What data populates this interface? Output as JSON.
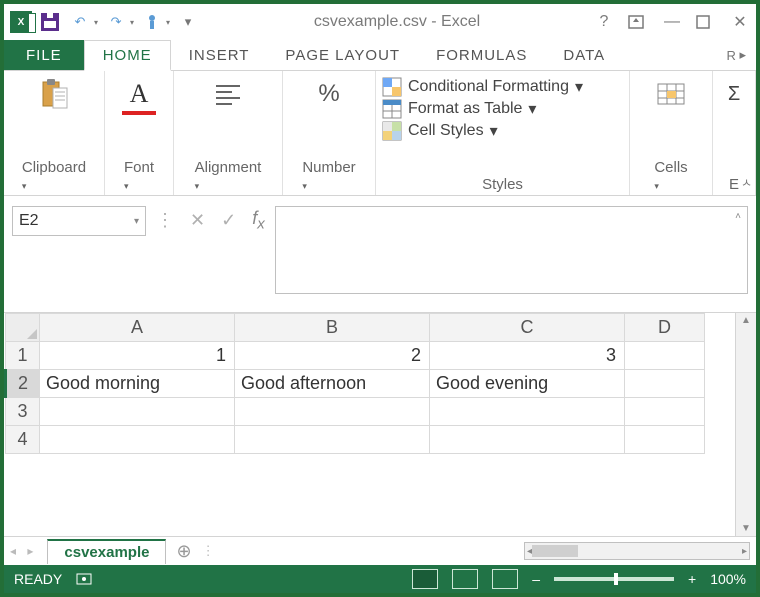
{
  "title": "csvexample.csv - Excel",
  "tabs": {
    "file": "FILE",
    "home": "HOME",
    "insert": "INSERT",
    "page_layout": "PAGE LAYOUT",
    "formulas": "FORMULAS",
    "data": "DATA",
    "overflow": "R"
  },
  "ribbon": {
    "clipboard": "Clipboard",
    "font": "Font",
    "alignment": "Alignment",
    "number": "Number",
    "styles_label": "Styles",
    "cond_fmt": "Conditional Formatting",
    "fmt_table": "Format as Table",
    "cell_styles": "Cell Styles",
    "cells": "Cells",
    "editing": "E"
  },
  "name_box": "E2",
  "formula_value": "",
  "columns": [
    "A",
    "B",
    "C",
    "D"
  ],
  "rows": [
    "1",
    "2",
    "3",
    "4"
  ],
  "cells": {
    "A1": "1",
    "B1": "2",
    "C1": "3",
    "A2": "Good morning",
    "B2": "Good afternoon",
    "C2": "Good evening"
  },
  "sheet_tab": "csvexample",
  "status": {
    "ready": "READY",
    "zoom": "100%"
  }
}
